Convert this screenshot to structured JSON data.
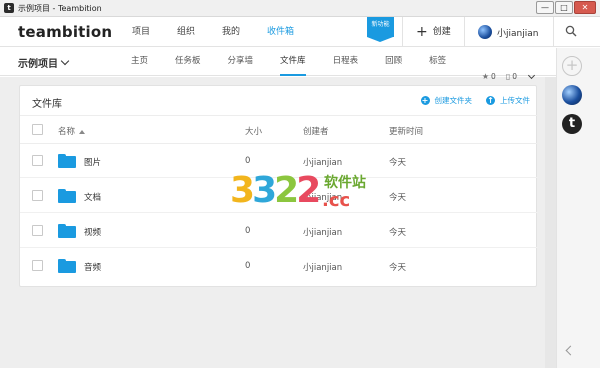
{
  "window": {
    "title": "示例项目 - Teambition",
    "app_icon_letter": "t",
    "buttons": {
      "minimize": "—",
      "maximize": "□",
      "close": "✕"
    }
  },
  "topnav": {
    "logo": "teambition",
    "items": [
      {
        "label": "项目",
        "active": false
      },
      {
        "label": "组织",
        "active": false
      },
      {
        "label": "我的",
        "active": false
      },
      {
        "label": "收件箱",
        "active": true
      }
    ],
    "new_feature_badge": "新功能",
    "create_label": "创建",
    "user_name": "小jianjian"
  },
  "subnav": {
    "project_name": "示例项目",
    "tabs": [
      {
        "label": "主页",
        "active": false
      },
      {
        "label": "任务板",
        "active": false
      },
      {
        "label": "分享墙",
        "active": false
      },
      {
        "label": "文件库",
        "active": true
      },
      {
        "label": "日程表",
        "active": false
      },
      {
        "label": "回顾",
        "active": false
      },
      {
        "label": "标签",
        "active": false
      }
    ]
  },
  "library": {
    "title": "文件库",
    "star_count": "0",
    "doc_count": "0",
    "actions": {
      "create_folder": "创建文件夹",
      "upload_file": "上传文件"
    },
    "columns": {
      "name": "名称",
      "size": "大小",
      "creator": "创建者",
      "updated": "更新时间"
    },
    "rows": [
      {
        "name": "图片",
        "size": "0",
        "creator": "小jianjian",
        "updated": "今天"
      },
      {
        "name": "文档",
        "size": "0",
        "creator": "小jianjian",
        "updated": "今天"
      },
      {
        "name": "视频",
        "size": "0",
        "creator": "小jianjian",
        "updated": "今天"
      },
      {
        "name": "音频",
        "size": "0",
        "creator": "小jianjian",
        "updated": "今天"
      }
    ]
  },
  "sidebar_right": {
    "teambition_letter": "t"
  },
  "watermark": {
    "digits": "3322",
    "text": "软件站",
    "domain": ".cc"
  },
  "colors": {
    "accent": "#1a9ae0",
    "folder": "#1a9ae0",
    "background": "#eeeeee"
  }
}
